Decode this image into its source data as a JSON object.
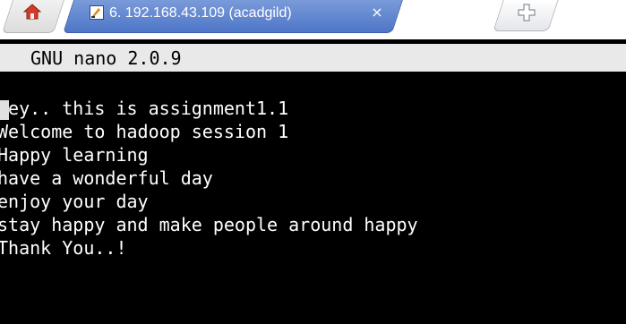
{
  "window": {
    "tab_title": "6. 192.168.43.109 (acadgild)",
    "tab_close_glyph": "×",
    "icons": {
      "home": "home-icon",
      "app": "terminal-app-icon",
      "close": "close-icon",
      "new_tab": "new-tab-icon"
    },
    "colors": {
      "active_tab": "#4e77c8",
      "terminal_bg": "#000000",
      "terminal_fg": "#ffffff",
      "header_bar": "#e9e9e9"
    }
  },
  "nano": {
    "header": "GNU nano 2.0.9"
  },
  "editor": {
    "lines": [
      "Hey.. this is assignment1.1",
      "Welcome to hadoop session 1",
      "Happy learning",
      "have a wonderful day",
      "enjoy your day",
      "stay happy and make people around happy",
      "Thank You..!"
    ]
  }
}
